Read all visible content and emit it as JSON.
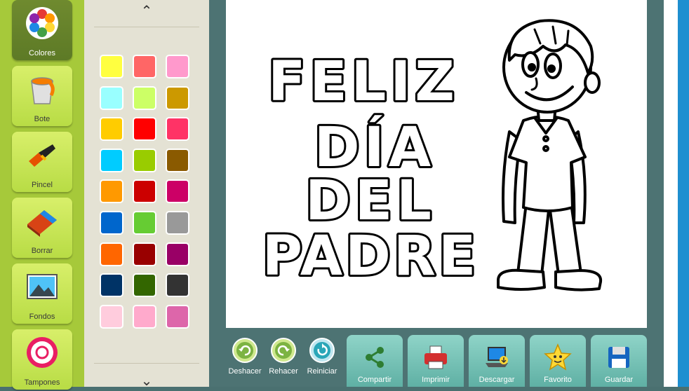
{
  "tools": [
    {
      "label": "Colores",
      "icon": "palette-icon",
      "active": true
    },
    {
      "label": "Bote",
      "icon": "paint-bucket-icon",
      "active": false
    },
    {
      "label": "Pincel",
      "icon": "brush-icon",
      "active": false
    },
    {
      "label": "Borrar",
      "icon": "eraser-icon",
      "active": false
    },
    {
      "label": "Fondos",
      "icon": "landscape-icon",
      "active": false
    },
    {
      "label": "Tampones",
      "icon": "stamp-icon",
      "active": false
    }
  ],
  "palette": {
    "up_arrow": "⌃",
    "down_arrow": "⌄",
    "colors": [
      "#ffff40",
      "#ff6666",
      "#ff99cc",
      "#99ffff",
      "#ccff66",
      "#cc9900",
      "#ffcc00",
      "#ff0000",
      "#ff3366",
      "#00ccff",
      "#99cc00",
      "#8a5a00",
      "#ff9900",
      "#cc0000",
      "#cc0066",
      "#0066cc",
      "#66cc33",
      "#999999",
      "#ff6600",
      "#990000",
      "#990066",
      "#003366",
      "#336600",
      "#333333",
      "#ffccdd",
      "#ffaacc",
      "#dd66aa"
    ]
  },
  "canvas": {
    "lines": [
      "FELIZ",
      "DÍA",
      "DEL",
      "PADRE"
    ]
  },
  "actions": {
    "undo": "Deshacer",
    "redo": "Rehacer",
    "reset": "Reiniciar"
  },
  "buttons": [
    {
      "label": "Compartir",
      "icon": "share-icon"
    },
    {
      "label": "Imprimir",
      "icon": "printer-icon"
    },
    {
      "label": "Descargar",
      "icon": "laptop-download-icon"
    },
    {
      "label": "Favorito",
      "icon": "star-icon"
    },
    {
      "label": "Guardar",
      "icon": "floppy-disk-icon"
    }
  ]
}
